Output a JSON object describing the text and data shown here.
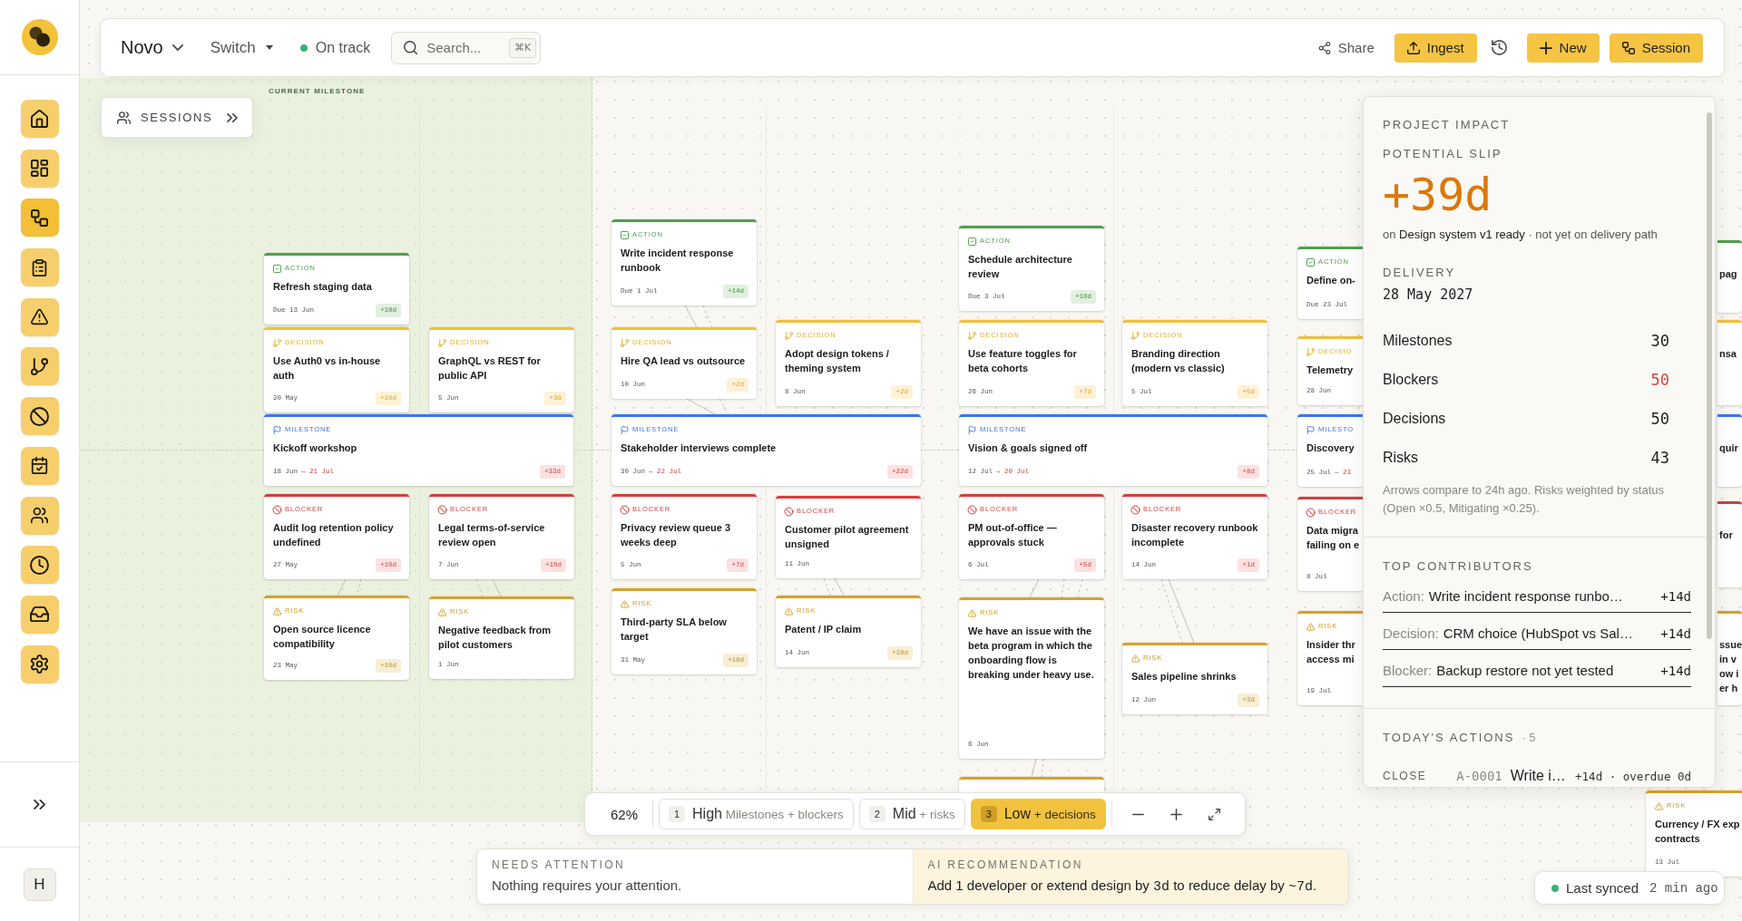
{
  "sidebar": {
    "items": [
      {
        "selected": false
      },
      {
        "selected": false
      },
      {
        "selected": true
      },
      {
        "selected": false
      },
      {
        "selected": false
      },
      {
        "selected": false
      },
      {
        "selected": false
      },
      {
        "selected": false
      },
      {
        "selected": false
      },
      {
        "selected": false
      },
      {
        "selected": false
      },
      {
        "selected": false
      }
    ],
    "user_initial": "H"
  },
  "topbar": {
    "project": "Novo",
    "switch": "Switch",
    "status": {
      "label": "On track",
      "healthy": true
    },
    "search": {
      "placeholder": "Search...",
      "shortcut": "⌘K"
    },
    "actions": [
      {
        "kind": "plain",
        "label": "Share"
      },
      {
        "kind": "primary",
        "label": "Ingest"
      },
      {
        "kind": "icon"
      },
      {
        "kind": "primary",
        "label": "New"
      },
      {
        "kind": "primary",
        "label": "Session"
      }
    ]
  },
  "sessions_button": {
    "label": "SESSIONS"
  },
  "canvas": {
    "zone_label": "CURRENT MILESTONE",
    "cards": [
      {
        "kind": "action",
        "label": "ACTION",
        "title": "Refresh staging data",
        "date": "Due 13 Jun",
        "slip": "+10d"
      },
      {
        "kind": "decision",
        "label": "DECISION",
        "title": "Use Auth0 vs in-house auth",
        "date": "20 May",
        "slip": "+10d"
      },
      {
        "kind": "decision",
        "label": "DECISION",
        "title": "GraphQL vs REST for public API",
        "date": "5 Jun",
        "slip": "+3d"
      },
      {
        "kind": "milestone",
        "label": "MILESTONE",
        "title": "Kickoff workshop",
        "date": "18 Jun",
        "slipped_to": "→ 21 Jul",
        "slip": "+33d"
      },
      {
        "kind": "blocker",
        "label": "BLOCKER",
        "title": "Audit log retention policy undefined",
        "date": "27 May",
        "slip": "+10d"
      },
      {
        "kind": "blocker",
        "label": "BLOCKER",
        "title": "Legal terms-of-service review open",
        "date": "7 Jun",
        "slip": "+10d"
      },
      {
        "kind": "risk",
        "label": "RISK",
        "title": "Open source licence compatibility",
        "date": "23 May",
        "slip": "+10d"
      },
      {
        "kind": "risk",
        "label": "RISK",
        "title": "Negative feedback from pilot customers",
        "date": "1 Jun"
      },
      {
        "kind": "action",
        "label": "ACTION",
        "title": "Write incident response runbook",
        "date": "Due 1 Jul",
        "slip": "+14d"
      },
      {
        "kind": "decision",
        "label": "DECISION",
        "title": "Hire QA lead vs outsource",
        "date": "10 Jun",
        "slip": "+2d"
      },
      {
        "kind": "decision",
        "label": "DECISION",
        "title": "Adopt design tokens / theming system",
        "date": "8 Jun",
        "slip": "+2d"
      },
      {
        "kind": "milestone",
        "label": "MILESTONE",
        "title": "Stakeholder interviews complete",
        "date": "30 Jun",
        "slipped_to": "→ 22 Jul",
        "slip": "+22d"
      },
      {
        "kind": "blocker",
        "label": "BLOCKER",
        "title": "Privacy review queue 3 weeks deep",
        "date": "5 Jun",
        "slip": "+7d"
      },
      {
        "kind": "blocker",
        "label": "BLOCKER",
        "title": "Customer pilot agreement unsigned",
        "date": "11 Jun"
      },
      {
        "kind": "risk",
        "label": "RISK",
        "title": "Third-party SLA below target",
        "date": "31 May",
        "slip": "+10d"
      },
      {
        "kind": "risk",
        "label": "RISK",
        "title": "Patent / IP claim",
        "date": "14 Jun",
        "slip": "+10d"
      },
      {
        "kind": "action",
        "label": "ACTION",
        "title": "Schedule architecture review",
        "date": "Due 3 Jul",
        "slip": "+10d"
      },
      {
        "kind": "decision",
        "label": "DECISION",
        "title": "Use feature toggles for beta cohorts",
        "date": "26 Jun",
        "slip": "+7d"
      },
      {
        "kind": "decision",
        "label": "DECISION",
        "title": "Branding direction (modern vs classic)",
        "date": "5 Jul",
        "slip": "+5d"
      },
      {
        "kind": "milestone",
        "label": "MILESTONE",
        "title": "Vision & goals signed off",
        "date": "12 Jul",
        "slipped_to": "→ 20 Jul",
        "slip": "+8d"
      },
      {
        "kind": "blocker",
        "label": "BLOCKER",
        "title": "PM out-of-office — approvals stuck",
        "date": "6 Jul",
        "slip": "+5d"
      },
      {
        "kind": "blocker",
        "label": "BLOCKER",
        "title": "Disaster recovery runbook incomplete",
        "date": "14 Jun",
        "slip": "+1d"
      },
      {
        "kind": "risk",
        "label": "RISK",
        "title": "We have an issue with the beta program in which the onboarding flow is breaking under heavy use.",
        "date": "6 Jun"
      },
      {
        "kind": "risk",
        "label": "RISK",
        "title": "Sales pipeline shrinks",
        "date": "12 Jun",
        "slip": "+3d"
      },
      {
        "kind": "risk"
      },
      {
        "kind": "action",
        "label": "ACTION",
        "title": "Define on-",
        "date": "Due 23 Jul"
      },
      {
        "kind": "decision",
        "label": "DECISIO",
        "title": "Telemetry",
        "date": "28 Jun"
      },
      {
        "kind": "milestone",
        "label": "MILESTO",
        "title": "Discovery",
        "date": "25 Jul",
        "slipped_to": "→ 23"
      },
      {
        "kind": "blocker",
        "label": "BLOCKER",
        "title": "Data migra\nfailing on e",
        "date": "8 Jul"
      },
      {
        "kind": "risk",
        "label": "RISK",
        "title": "Insider thr\naccess mi",
        "date": "19 Jul"
      },
      {
        "kind": "action",
        "title": "pag"
      },
      {
        "kind": "decision",
        "title": "nsa"
      },
      {
        "kind": "milestone",
        "title": "quir"
      },
      {
        "kind": "blocker",
        "title": "for"
      },
      {
        "kind": "risk",
        "title": "ssue\nin v\now i\ner h"
      },
      {
        "kind": "risk",
        "label": "RISK",
        "title": "Currency / FX exp\ncontracts",
        "date": "13 Jul"
      }
    ],
    "links": [
      {
        "dashed": false
      },
      {
        "dashed": true
      },
      {
        "dashed": false
      },
      {
        "dashed": true
      },
      {
        "dashed": false
      },
      {
        "dashed": true
      },
      {
        "dashed": true
      },
      {
        "dashed": false
      },
      {
        "dashed": true
      },
      {
        "dashed": false
      },
      {
        "dashed": false
      },
      {
        "dashed": true
      },
      {
        "dashed": true
      },
      {
        "dashed": false
      },
      {
        "dashed": true
      },
      {
        "dashed": true
      },
      {
        "dashed": false
      }
    ]
  },
  "impact_panel": {
    "title": "PROJECT IMPACT",
    "slip_label": "POTENTIAL SLIP",
    "slip": "+39d",
    "slip_note": "on **Design system v1 ready** · not yet on delivery path",
    "delivery_label": "DELIVERY",
    "delivery": "28 May 2027",
    "stats": [
      {
        "label": "Milestones",
        "value": "30",
        "warning": false
      },
      {
        "label": "Blockers",
        "value": "50",
        "warning": true
      },
      {
        "label": "Decisions",
        "value": "50",
        "warning": false
      },
      {
        "label": "Risks",
        "value": "43",
        "warning": false
      }
    ],
    "footnote": "Arrows compare to 24h ago. Risks weighted by status (Open ×0.5, Mitigating ×0.25).",
    "contributors_title": "TOP CONTRIBUTORS",
    "contributors": [
      {
        "type": "Action:",
        "name": "Write incident response runbo…",
        "slip": "+14d"
      },
      {
        "type": "Decision:",
        "name": "CRM choice (HubSpot vs Sal…",
        "slip": "+14d"
      },
      {
        "type": "Blocker:",
        "name": "Backup restore not yet tested",
        "slip": "+14d"
      }
    ],
    "actions_title": "TODAY'S ACTIONS",
    "actions_count": "· 5",
    "actions": [
      {
        "verb": "CLOSE",
        "id": "A-0001",
        "name": "Write i…",
        "meta": "+14d · overdue 0d"
      }
    ]
  },
  "zoom_bar": {
    "zoom": "62%",
    "levels": [
      {
        "key": "1",
        "name": "High",
        "detail": "Milestones + blockers",
        "selected": false
      },
      {
        "key": "2",
        "name": "Mid",
        "detail": "+ risks",
        "selected": false
      },
      {
        "key": "3",
        "name": "Low",
        "detail": "+ decisions",
        "selected": true
      }
    ]
  },
  "insights": {
    "attention": {
      "label": "NEEDS ATTENTION",
      "message": "Nothing requires your attention."
    },
    "recommendation": {
      "label": "AI RECOMMENDATION",
      "message": "Add 1 developer or extend design by **3d** to reduce delay by **~7d**."
    }
  },
  "sync_status": {
    "label": "Last synced",
    "time": "2 min ago",
    "connected": true
  }
}
